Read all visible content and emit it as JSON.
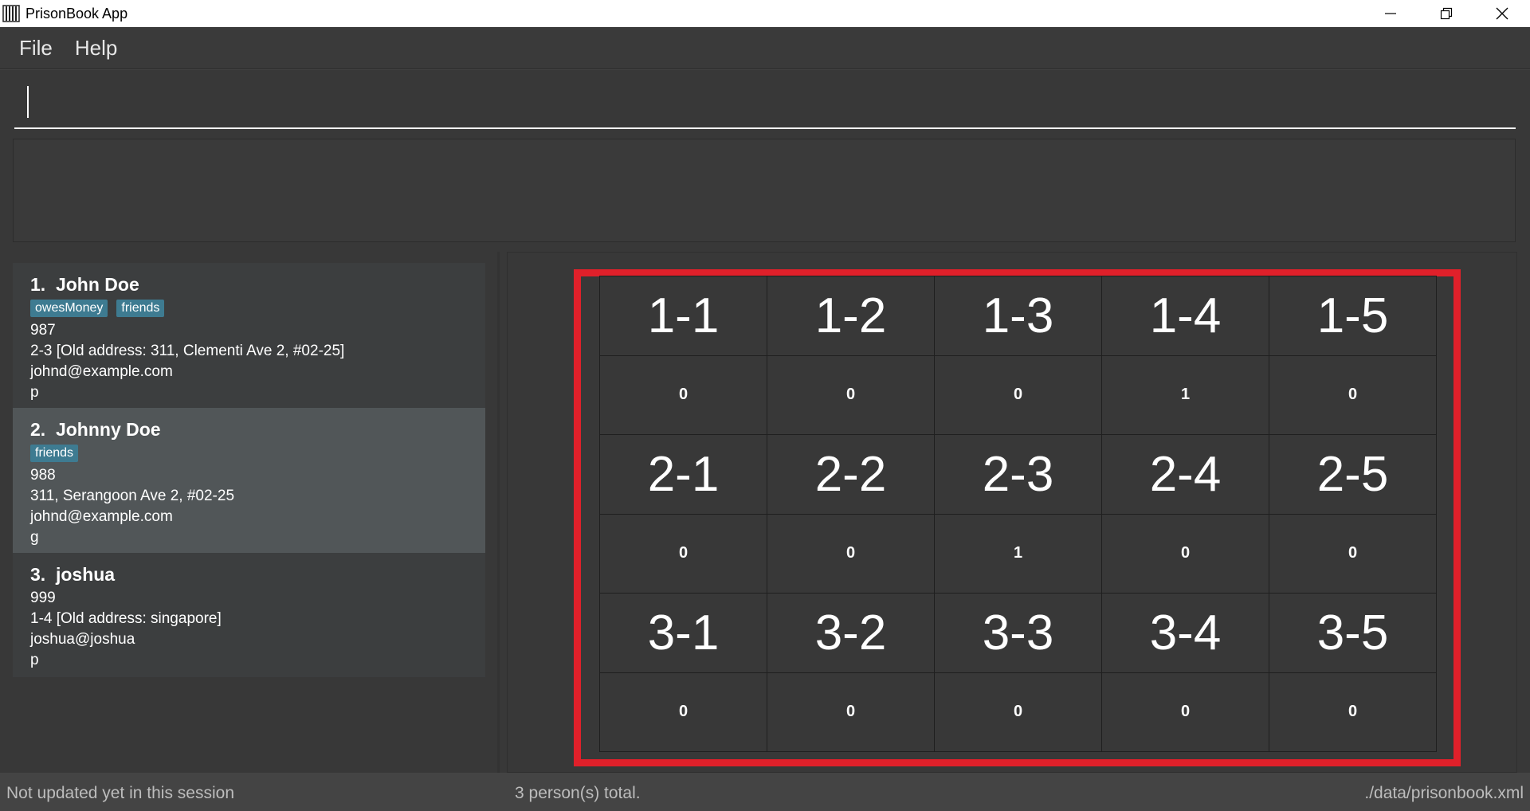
{
  "window": {
    "title": "PrisonBook App",
    "controls": [
      "minimize-icon",
      "restore-icon",
      "close-icon"
    ]
  },
  "menu": [
    {
      "label": "File"
    },
    {
      "label": "Help"
    }
  ],
  "command_box": {
    "value": "",
    "placeholder": ""
  },
  "result_display": {
    "text": ""
  },
  "persons": [
    {
      "index": "1.",
      "name": "John Doe",
      "tags": [
        "owesMoney",
        "friends"
      ],
      "phone": "987",
      "address": "2-3 [Old address: 311, Clementi Ave 2, #02-25]",
      "email": "johnd@example.com",
      "extra": "p",
      "selected": false
    },
    {
      "index": "2.",
      "name": "Johnny Doe",
      "tags": [
        "friends"
      ],
      "phone": "988",
      "address": "311, Serangoon Ave 2, #02-25",
      "email": "johnd@example.com",
      "extra": "g",
      "selected": true
    },
    {
      "index": "3.",
      "name": "joshua",
      "tags": [],
      "phone": "999",
      "address": "1-4 [Old address: singapore]",
      "email": "joshua@joshua",
      "extra": "p",
      "selected": false
    }
  ],
  "cells": {
    "rows": [
      {
        "labels": [
          "1-1",
          "1-2",
          "1-3",
          "1-4",
          "1-5"
        ],
        "counts": [
          "0",
          "0",
          "0",
          "1",
          "0"
        ]
      },
      {
        "labels": [
          "2-1",
          "2-2",
          "2-3",
          "2-4",
          "2-5"
        ],
        "counts": [
          "0",
          "0",
          "1",
          "0",
          "0"
        ]
      },
      {
        "labels": [
          "3-1",
          "3-2",
          "3-3",
          "3-4",
          "3-5"
        ],
        "counts": [
          "0",
          "0",
          "0",
          "0",
          "0"
        ]
      }
    ],
    "highlight_color": "#e0202a"
  },
  "status": {
    "sync": "Not updated yet in this session",
    "total": "3 person(s) total.",
    "path": "./data/prisonbook.xml"
  }
}
